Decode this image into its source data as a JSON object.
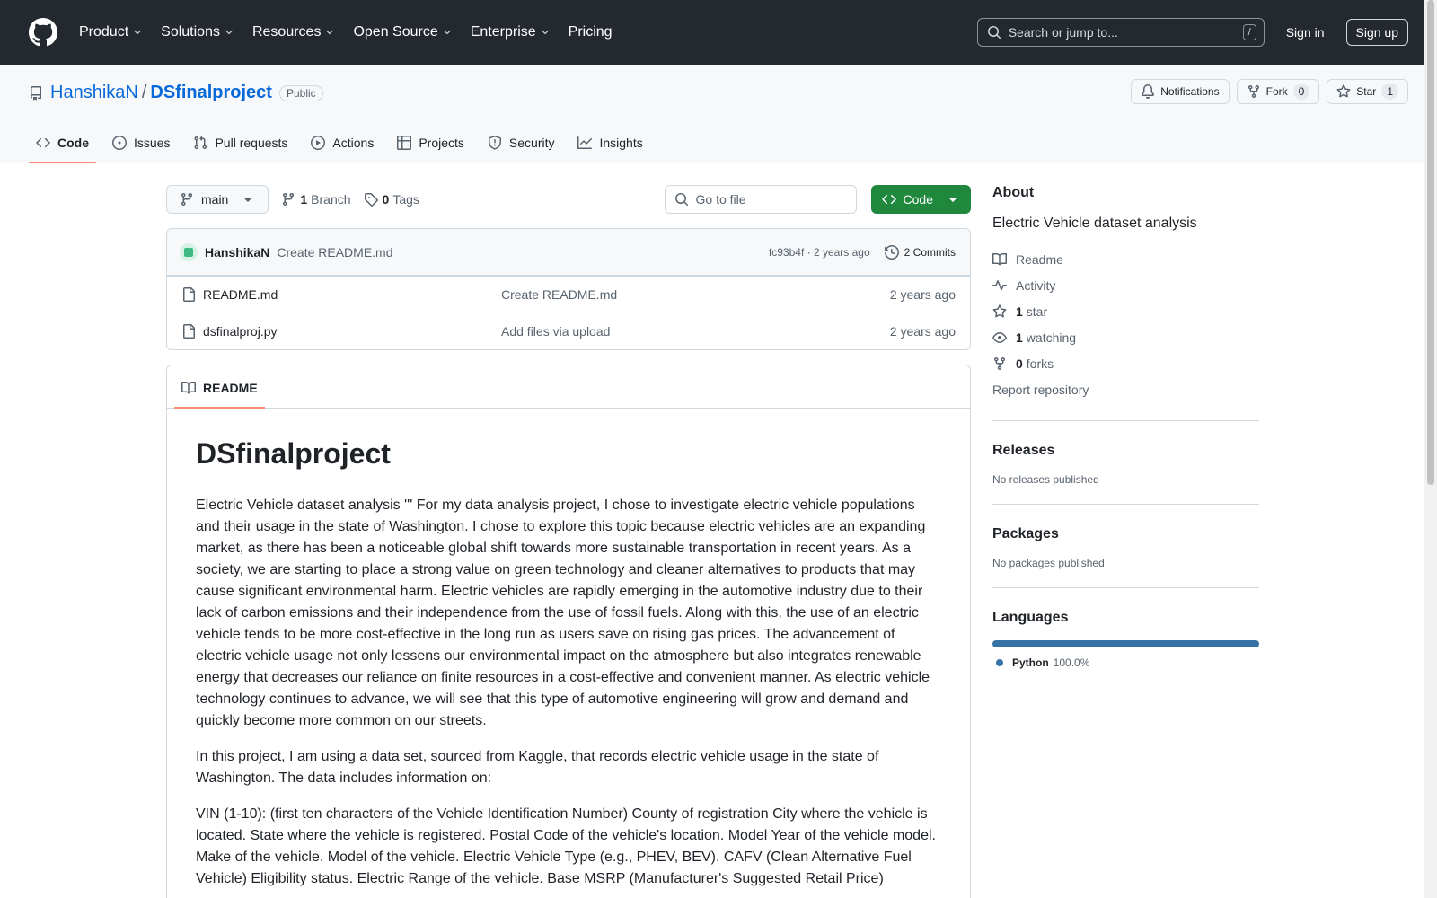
{
  "header": {
    "nav": [
      "Product",
      "Solutions",
      "Resources",
      "Open Source",
      "Enterprise",
      "Pricing"
    ],
    "search_placeholder": "Search or jump to...",
    "search_shortcut": "/",
    "sign_in": "Sign in",
    "sign_up": "Sign up"
  },
  "repo": {
    "owner": "HanshikaN",
    "separator": "/",
    "name": "DSfinalproject",
    "visibility": "Public",
    "notifications_label": "Notifications",
    "fork_label": "Fork",
    "fork_count": "0",
    "star_label": "Star",
    "star_count": "1"
  },
  "tabs": [
    "Code",
    "Issues",
    "Pull requests",
    "Actions",
    "Projects",
    "Security",
    "Insights"
  ],
  "toolbar": {
    "branch": "main",
    "branch_count": "1",
    "branch_label": "Branch",
    "tag_count": "0",
    "tag_label": "Tags",
    "goto_placeholder": "Go to file",
    "code_button": "Code"
  },
  "latest_commit": {
    "author": "HanshikaN",
    "message": "Create README.md",
    "hash_time": "fc93b4f · 2 years ago",
    "commits": "2 Commits"
  },
  "files": [
    {
      "name": "README.md",
      "message": "Create README.md",
      "date": "2 years ago"
    },
    {
      "name": "dsfinalproj.py",
      "message": "Add files via upload",
      "date": "2 years ago"
    }
  ],
  "readme": {
    "tab": "README",
    "title": "DSfinalproject",
    "paragraphs": [
      "Electric Vehicle dataset analysis ''' For my data analysis project, I chose to investigate electric vehicle populations and their usage in the state of Washington. I chose to explore this topic because electric vehicles are an expanding market, as there has been a noticeable global shift towards more sustainable transportation in recent years. As a society, we are starting to place a strong value on green technology and cleaner alternatives to products that may cause significant environmental harm. Electric vehicles are rapidly emerging in the automotive industry due to their lack of carbon emissions and their independence from the use of fossil fuels. Along with this, the use of an electric vehicle tends to be more cost-effective in the long run as users save on rising gas prices. The advancement of electric vehicle usage not only lessens our environmental impact on the atmosphere but also integrates renewable energy that decreases our reliance on finite resources in a cost-effective and convenient manner. As electric vehicle technology continues to advance, we will see that this type of automotive engineering will grow and demand and quickly become more common on our streets.",
      "In this project, I am using a data set, sourced from Kaggle, that records electric vehicle usage in the state of Washington. The data includes information on:",
      "VIN (1-10): (first ten characters of the Vehicle Identification Number) County of registration City where the vehicle is located. State where the vehicle is registered. Postal Code of the vehicle's location. Model Year of the vehicle model. Make of the vehicle. Model of the vehicle. Electric Vehicle Type (e.g., PHEV, BEV). CAFV (Clean Alternative Fuel Vehicle) Eligibility status. Electric Range of the vehicle. Base MSRP (Manufacturer's Suggested Retail Price)"
    ]
  },
  "sidebar": {
    "about_title": "About",
    "description": "Electric Vehicle dataset analysis",
    "readme": "Readme",
    "activity": "Activity",
    "stars_count": "1",
    "stars_label": "star",
    "watching_count": "1",
    "watching_label": "watching",
    "forks_count": "0",
    "forks_label": "forks",
    "report": "Report repository",
    "releases_title": "Releases",
    "releases_text": "No releases published",
    "packages_title": "Packages",
    "packages_text": "No packages published",
    "languages_title": "Languages",
    "language_name": "Python",
    "language_pct": "100.0%",
    "language_share": 1.0,
    "language_color": "#3572a5"
  }
}
